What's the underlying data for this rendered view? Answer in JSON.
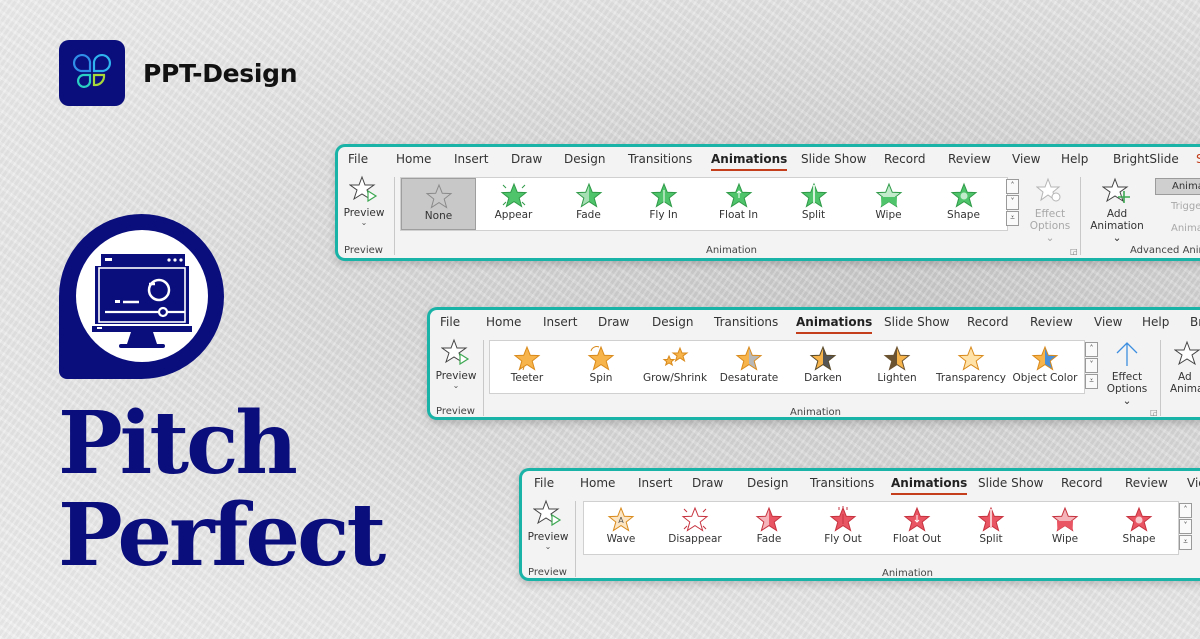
{
  "brand": {
    "name": "PPT-Design"
  },
  "headline": {
    "line1": "Pitch",
    "line2": "Perfect"
  },
  "colors": {
    "navy": "#0a0e7c",
    "teal_border": "#19b3a7",
    "active_tab_underline": "#c43e1c",
    "entrance_green": "#3cbd5a",
    "emphasis_orange": "#f0a32f",
    "exit_red": "#e34855"
  },
  "ribbon1": {
    "tabs": [
      "File",
      "Home",
      "Insert",
      "Draw",
      "Design",
      "Transitions",
      "Animations",
      "Slide Show",
      "Record",
      "Review",
      "View",
      "Help",
      "BrightSlide",
      "S"
    ],
    "active_tab": "Animations",
    "preview": {
      "label": "Preview",
      "group": "Preview"
    },
    "gallery": [
      {
        "label": "None",
        "icon": "star-outline-icon",
        "selected": true
      },
      {
        "label": "Appear",
        "icon": "star-appear-icon"
      },
      {
        "label": "Fade",
        "icon": "star-fade-icon"
      },
      {
        "label": "Fly In",
        "icon": "star-fly-in-icon"
      },
      {
        "label": "Float In",
        "icon": "star-float-in-icon"
      },
      {
        "label": "Split",
        "icon": "star-split-icon"
      },
      {
        "label": "Wipe",
        "icon": "star-wipe-icon"
      },
      {
        "label": "Shape",
        "icon": "star-shape-icon"
      }
    ],
    "group_label": "Animation",
    "effect_options": {
      "line1": "Effect",
      "line2": "Options"
    },
    "add_animation": {
      "line1": "Add",
      "line2": "Animation"
    },
    "advanced": {
      "pane": "Animation Pane",
      "trigger": "Trigger",
      "painter": "Animation Painter",
      "group": "Advanced Animation"
    }
  },
  "ribbon2": {
    "tabs": [
      "File",
      "Home",
      "Insert",
      "Draw",
      "Design",
      "Transitions",
      "Animations",
      "Slide Show",
      "Record",
      "Review",
      "View",
      "Help",
      "Br"
    ],
    "active_tab": "Animations",
    "preview": {
      "label": "Preview",
      "group": "Preview"
    },
    "gallery": [
      {
        "label": "Teeter",
        "icon": "star-teeter-icon"
      },
      {
        "label": "Spin",
        "icon": "star-spin-icon"
      },
      {
        "label": "Grow/Shrink",
        "icon": "star-grow-shrink-icon"
      },
      {
        "label": "Desaturate",
        "icon": "star-desaturate-icon"
      },
      {
        "label": "Darken",
        "icon": "star-darken-icon"
      },
      {
        "label": "Lighten",
        "icon": "star-lighten-icon"
      },
      {
        "label": "Transparency",
        "icon": "star-transparency-icon"
      },
      {
        "label": "Object Color",
        "icon": "star-object-color-icon"
      }
    ],
    "group_label": "Animation",
    "effect_options": {
      "line1": "Effect",
      "line2": "Options"
    },
    "add_animation": {
      "line1": "Ad",
      "line2": "Anima"
    }
  },
  "ribbon3": {
    "tabs": [
      "File",
      "Home",
      "Insert",
      "Draw",
      "Design",
      "Transitions",
      "Animations",
      "Slide Show",
      "Record",
      "Review",
      "Vie"
    ],
    "active_tab": "Animations",
    "preview": {
      "label": "Preview",
      "group": "Preview"
    },
    "gallery": [
      {
        "label": "Wave",
        "icon": "star-wave-icon"
      },
      {
        "label": "Disappear",
        "icon": "star-disappear-icon"
      },
      {
        "label": "Fade",
        "icon": "star-fade-out-icon"
      },
      {
        "label": "Fly Out",
        "icon": "star-fly-out-icon"
      },
      {
        "label": "Float Out",
        "icon": "star-float-out-icon"
      },
      {
        "label": "Split",
        "icon": "star-split-out-icon"
      },
      {
        "label": "Wipe",
        "icon": "star-wipe-out-icon"
      },
      {
        "label": "Shape",
        "icon": "star-shape-out-icon"
      }
    ],
    "group_label": "Animation"
  }
}
